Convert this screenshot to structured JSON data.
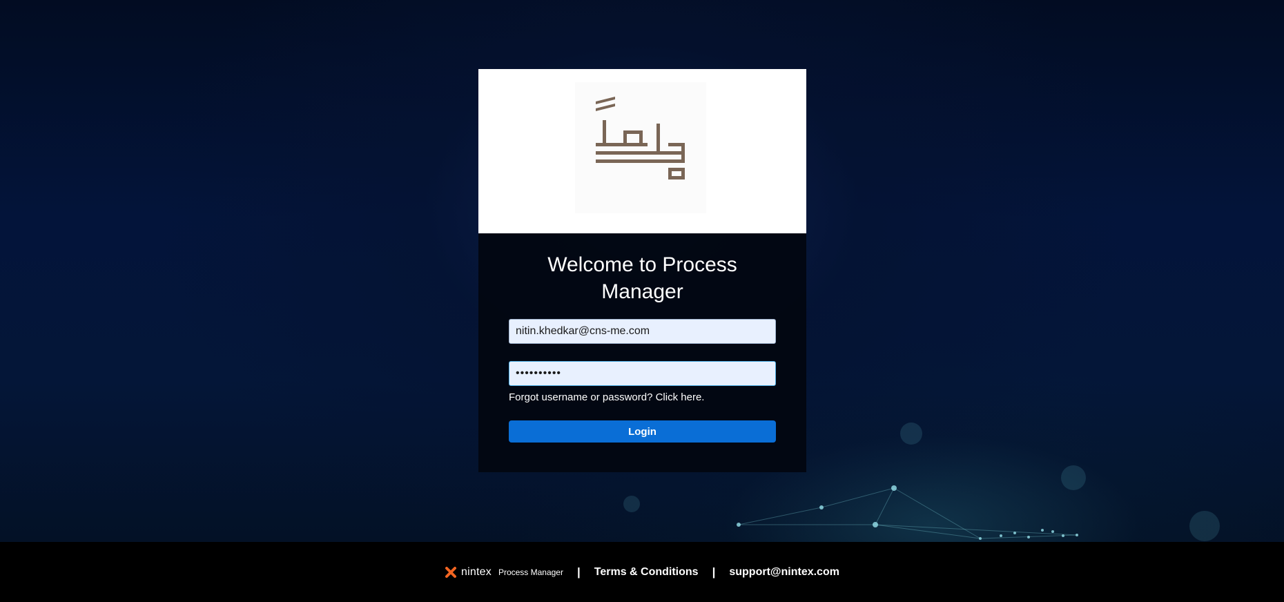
{
  "login": {
    "title": "Welcome to Process Manager",
    "username_value": "nitin.khedkar@cns-me.com",
    "password_value": "••••••••••",
    "forgot_label": "Forgot username or password? Click here.",
    "login_label": "Login"
  },
  "footer": {
    "brand_name": "nintex",
    "brand_product": "Process Manager",
    "separator": "|",
    "terms_label": "Terms & Conditions",
    "support_label": "support@nintex.com"
  },
  "colors": {
    "accent": "#0a6ed6",
    "logo": "#7a6656",
    "brand_x": "#f26522"
  },
  "icons": {
    "logo": "arabic-calligraphy-logo",
    "brand": "nintex-x-icon"
  }
}
